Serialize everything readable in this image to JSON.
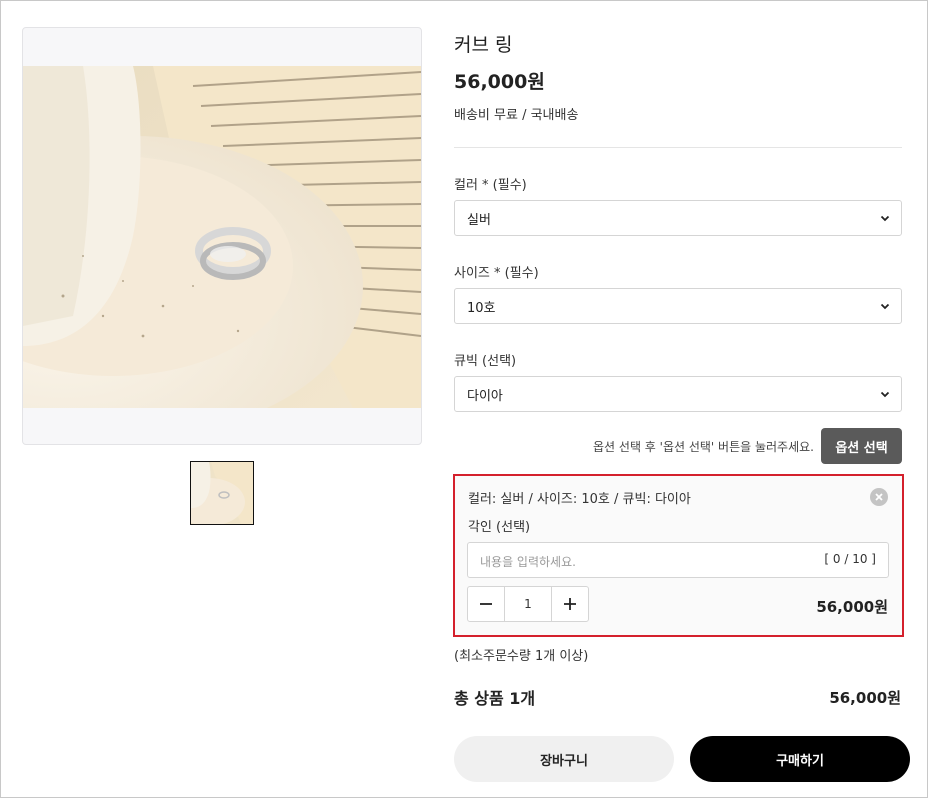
{
  "product": {
    "title": "커브 링",
    "price": "56,000원",
    "shipping": "배송비 무료 / 국내배송"
  },
  "options": [
    {
      "label": "컬러 * (필수)",
      "value": "실버"
    },
    {
      "label": "사이즈 * (필수)",
      "value": "10호"
    },
    {
      "label": "큐빅 (선택)",
      "value": "다이아"
    }
  ],
  "option_hint": "옵션 선택 후 '옵션 선택' 버튼을 눌러주세요.",
  "option_button": "옵션 선택",
  "selected_item": {
    "summary": "컬러: 실버 / 사이즈: 10호 / 큐빅: 다이아",
    "engrave_label": "각인 (선택)",
    "engrave_placeholder": "내용을 입력하세요.",
    "engrave_count": "[ 0 / 10 ]",
    "quantity": "1",
    "price": "56,000원"
  },
  "min_order": "(최소주문수량 1개 이상)",
  "total": {
    "label": "총 상품 1개",
    "price": "56,000원"
  },
  "buttons": {
    "cart": "장바구니",
    "buy": "구매하기"
  },
  "icons": {
    "dropdown": "chevron-down-icon",
    "remove": "close-circle-icon",
    "minus": "minus-icon",
    "plus": "plus-icon"
  },
  "colors": {
    "highlight_border": "#d4202c",
    "buy_button": "#000000",
    "option_button": "#5a5a5a"
  }
}
